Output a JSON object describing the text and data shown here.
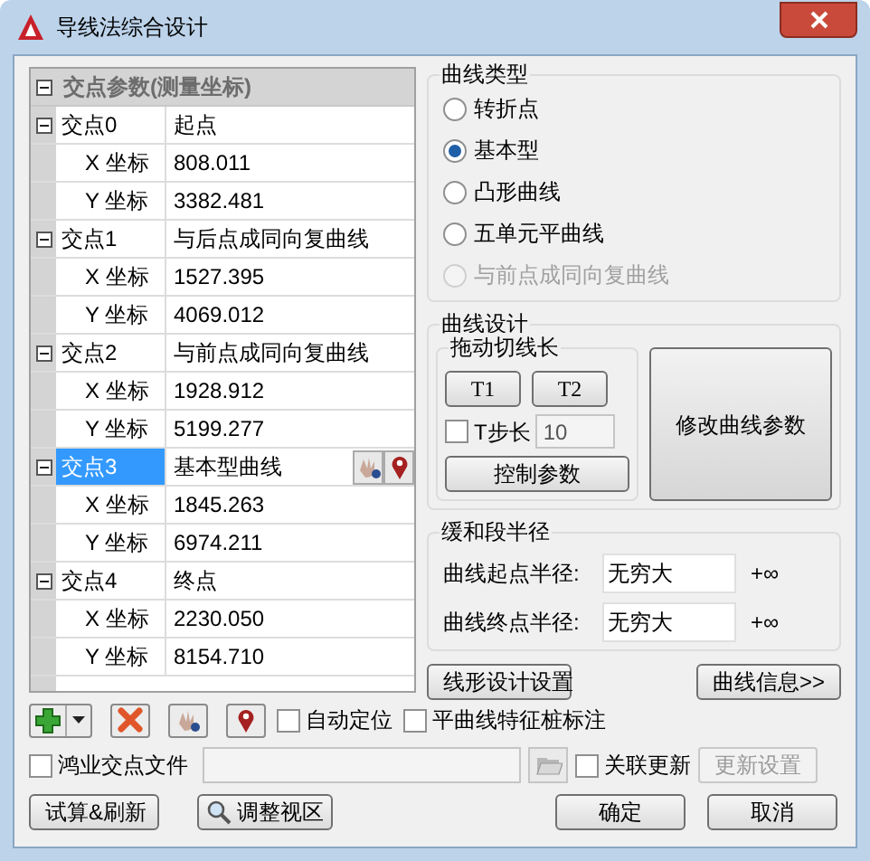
{
  "window": {
    "title": "导线法综合设计"
  },
  "tree": {
    "header": {
      "label": "交点参数(测量坐标)",
      "expanded": true
    },
    "nodes": [
      {
        "name": "交点0",
        "value": "起点",
        "expanded": true,
        "selected": false,
        "children": [
          {
            "name": "X 坐标",
            "value": "808.011"
          },
          {
            "name": "Y 坐标",
            "value": "3382.481"
          }
        ]
      },
      {
        "name": "交点1",
        "value": "与后点成同向复曲线",
        "expanded": true,
        "selected": false,
        "children": [
          {
            "name": "X 坐标",
            "value": "1527.395"
          },
          {
            "name": "Y 坐标",
            "value": "4069.012"
          }
        ]
      },
      {
        "name": "交点2",
        "value": "与前点成同向复曲线",
        "expanded": true,
        "selected": false,
        "children": [
          {
            "name": "X 坐标",
            "value": "1928.912"
          },
          {
            "name": "Y 坐标",
            "value": "5199.277"
          }
        ]
      },
      {
        "name": "交点3",
        "value": "基本型曲线",
        "expanded": true,
        "selected": true,
        "children": [
          {
            "name": "X 坐标",
            "value": "1845.263"
          },
          {
            "name": "Y 坐标",
            "value": "6974.211"
          }
        ]
      },
      {
        "name": "交点4",
        "value": "终点",
        "expanded": true,
        "selected": false,
        "children": [
          {
            "name": "X 坐标",
            "value": "2230.050"
          },
          {
            "name": "Y 坐标",
            "value": "8154.710"
          }
        ]
      }
    ]
  },
  "curve_type": {
    "label": "曲线类型",
    "options": [
      {
        "label": "转折点",
        "selected": false,
        "disabled": false
      },
      {
        "label": "基本型",
        "selected": true,
        "disabled": false
      },
      {
        "label": "凸形曲线",
        "selected": false,
        "disabled": false
      },
      {
        "label": "五单元平曲线",
        "selected": false,
        "disabled": false
      },
      {
        "label": "与前点成同向复曲线",
        "selected": false,
        "disabled": true
      }
    ]
  },
  "curve_design": {
    "label": "曲线设计",
    "drag": {
      "label": "拖动切线长",
      "buttons": [
        "T1",
        "T2"
      ],
      "step": {
        "label": "T步长",
        "checked": false,
        "value": "10"
      },
      "control_button": "控制参数"
    },
    "modify_button": "修改曲线参数"
  },
  "transition": {
    "label": "缓和段半径",
    "rows": [
      {
        "label": "曲线起点半径:",
        "value": "无穷大",
        "suffix": "+∞"
      },
      {
        "label": "曲线终点半径:",
        "value": "无穷大",
        "suffix": "+∞"
      }
    ]
  },
  "side_buttons": [
    "线形设计设置",
    "曲线信息>>"
  ],
  "toolbar": {
    "checks": [
      {
        "label": "自动定位",
        "checked": false
      },
      {
        "label": "平曲线特征桩标注",
        "checked": false
      }
    ]
  },
  "file_row": {
    "label": "鸿业交点文件",
    "checked": false,
    "link": {
      "label": "关联更新",
      "checked": false
    },
    "update_button": {
      "label": "更新设置",
      "disabled": true
    }
  },
  "footer": {
    "trial": "试算&刷新",
    "adjust": "调整视区",
    "ok": "确定",
    "cancel": "取消"
  }
}
